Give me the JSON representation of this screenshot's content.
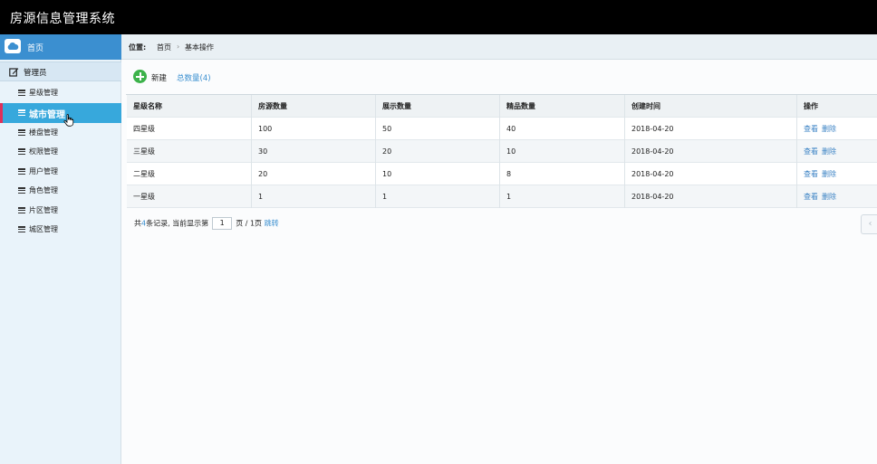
{
  "app": {
    "title": "房源信息管理系统"
  },
  "sidebar": {
    "home_label": "首页",
    "group_label": "管理员",
    "items": [
      {
        "label": "星级管理",
        "active": false
      },
      {
        "label": "城市管理",
        "active": true
      },
      {
        "label": "楼盘管理",
        "active": false
      },
      {
        "label": "权限管理",
        "active": false
      },
      {
        "label": "用户管理",
        "active": false
      },
      {
        "label": "角色管理",
        "active": false
      },
      {
        "label": "片区管理",
        "active": false
      },
      {
        "label": "城区管理",
        "active": false
      }
    ]
  },
  "breadcrumb": {
    "prefix": "位置:",
    "home": "首页",
    "separator": "›",
    "current": "基本操作"
  },
  "toolbar": {
    "new_label": "新建",
    "total_label": "总数量(4)"
  },
  "table": {
    "columns": [
      "星级名称",
      "房源数量",
      "展示数量",
      "精品数量",
      "创建时间",
      "操作"
    ],
    "rows": [
      {
        "name": "四星级",
        "houses": "100",
        "shown": "50",
        "premium": "40",
        "created": "2018-04-20",
        "view": "查看",
        "delete": "删除"
      },
      {
        "name": "三星级",
        "houses": "30",
        "shown": "20",
        "premium": "10",
        "created": "2018-04-20",
        "view": "查看",
        "delete": "删除"
      },
      {
        "name": "二星级",
        "houses": "20",
        "shown": "10",
        "premium": "8",
        "created": "2018-04-20",
        "view": "查看",
        "delete": "删除"
      },
      {
        "name": "一星级",
        "houses": "1",
        "shown": "1",
        "premium": "1",
        "created": "2018-04-20",
        "view": "查看",
        "delete": "删除"
      }
    ]
  },
  "pager": {
    "prefix": "共",
    "count": "4",
    "records_text": "条记录, 当前显示第",
    "page": "1",
    "page_suffix": "页 / 1页",
    "jump_label": "跳转"
  },
  "colors": {
    "topbar": "#000000",
    "accent": "#3b8fd0",
    "active_item": "#37a8dc",
    "link": "#3a82c4",
    "add_icon": "#3cb24a"
  },
  "icons": {
    "home": "cloud-icon",
    "group": "edit-icon",
    "menu": "list-icon",
    "add": "plus-circle-icon",
    "scroll": "chevron-left-icon"
  }
}
